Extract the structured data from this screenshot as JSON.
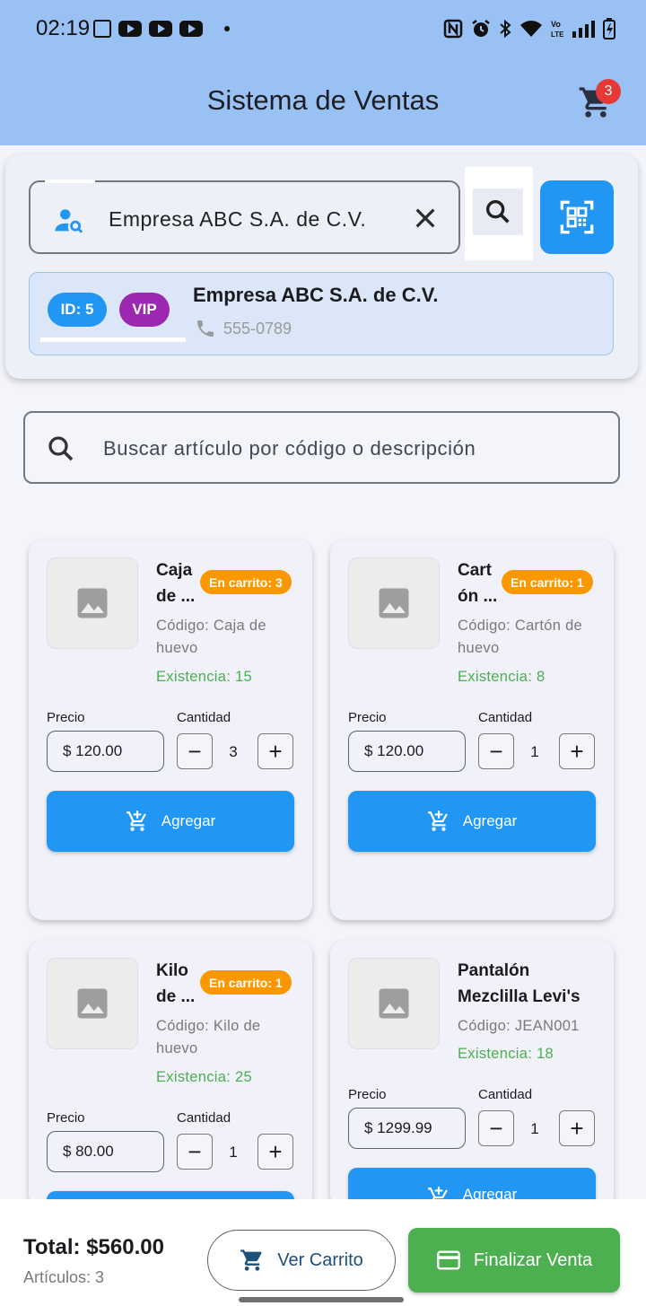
{
  "status": {
    "time": "02:19"
  },
  "app": {
    "title": "Sistema de Ventas",
    "cart_count": "3"
  },
  "client": {
    "search_value": "Empresa ABC S.A. de C.V.",
    "id_label": "ID: 5",
    "vip_label": "VIP",
    "name": "Empresa ABC S.A. de C.V.",
    "phone": "555-0789"
  },
  "item_search": {
    "placeholder": "Buscar artículo por código o descripción"
  },
  "labels": {
    "price": "Precio",
    "quantity": "Cantidad",
    "add": "Agregar",
    "minus": "−",
    "plus": "+"
  },
  "products": [
    {
      "name_line1": "Caja",
      "name_line2": "de ...",
      "badge": "En carrito: 3",
      "code_line1": "Código: Caja de",
      "code_line2": "huevo",
      "stock": "Existencia: 15",
      "price": "$ 120.00",
      "qty": "3"
    },
    {
      "name_line1": "Cart",
      "name_line2": "ón ...",
      "badge": "En carrito: 1",
      "code_line1": "Código: Cartón de",
      "code_line2": "huevo",
      "stock": "Existencia: 8",
      "price": "$ 120.00",
      "qty": "1"
    },
    {
      "name_line1": "Kilo",
      "name_line2": "de ...",
      "badge": "En carrito: 1",
      "code_line1": "Código: Kilo de",
      "code_line2": "huevo",
      "stock": "Existencia: 25",
      "price": "$ 80.00",
      "qty": "1"
    },
    {
      "name_line1": "Pantalón",
      "name_line2": "Mezclilla Levi's",
      "code_line1": "Código: JEAN001",
      "stock": "Existencia: 18",
      "price": "$ 1299.99",
      "qty": "1"
    }
  ],
  "footer": {
    "total": "Total: $560.00",
    "items": "Artículos: 3",
    "view_cart": "Ver Carrito",
    "finish": "Finalizar Venta"
  },
  "colors": {
    "appbar": "#99c1f3",
    "primary": "#2196f3",
    "vip": "#9c27b0",
    "badge": "#fb9800",
    "stock": "#4caf50",
    "finish": "#4caf50",
    "cart_badge": "#e53935"
  }
}
